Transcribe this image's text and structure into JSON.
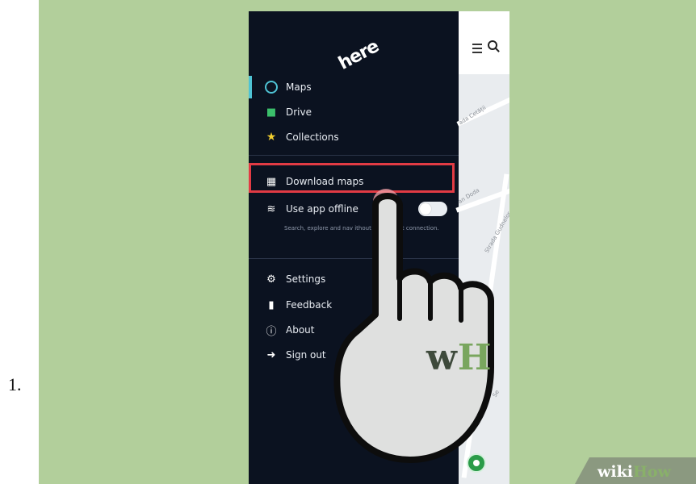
{
  "step_number": "1.",
  "app": {
    "logo_text": "here"
  },
  "menu": {
    "items": [
      {
        "label": "Maps",
        "icon": "compass-icon",
        "active": true
      },
      {
        "label": "Drive",
        "icon": "car-icon"
      },
      {
        "label": "Collections",
        "icon": "star-icon"
      },
      {
        "label": "Download maps",
        "icon": "map-download-icon",
        "highlighted": true
      },
      {
        "label": "Use app offline",
        "icon": "wifi-icon"
      },
      {
        "label": "Settings",
        "icon": "gear-icon"
      },
      {
        "label": "Feedback",
        "icon": "chat-icon"
      },
      {
        "label": "About",
        "icon": "info-icon"
      },
      {
        "label": "Sign out",
        "icon": "sign-out-icon"
      }
    ],
    "offline_description": "Search, explore and nav         ithout an internet connection.",
    "offline_toggle_on": false
  },
  "map": {
    "labels": [
      "ada Cetății",
      "an Doda",
      "Strada Gudnelor",
      "Se"
    ]
  },
  "watermark": {
    "hand_logo_w": "w",
    "hand_logo_h": "H",
    "brand_wiki": "wiki",
    "brand_how": "How"
  },
  "colors": {
    "panel_background": "#b2cf9b",
    "phone_background": "#0b1220",
    "highlight_border": "#e23b44",
    "active_accent": "#4fc3d4"
  }
}
